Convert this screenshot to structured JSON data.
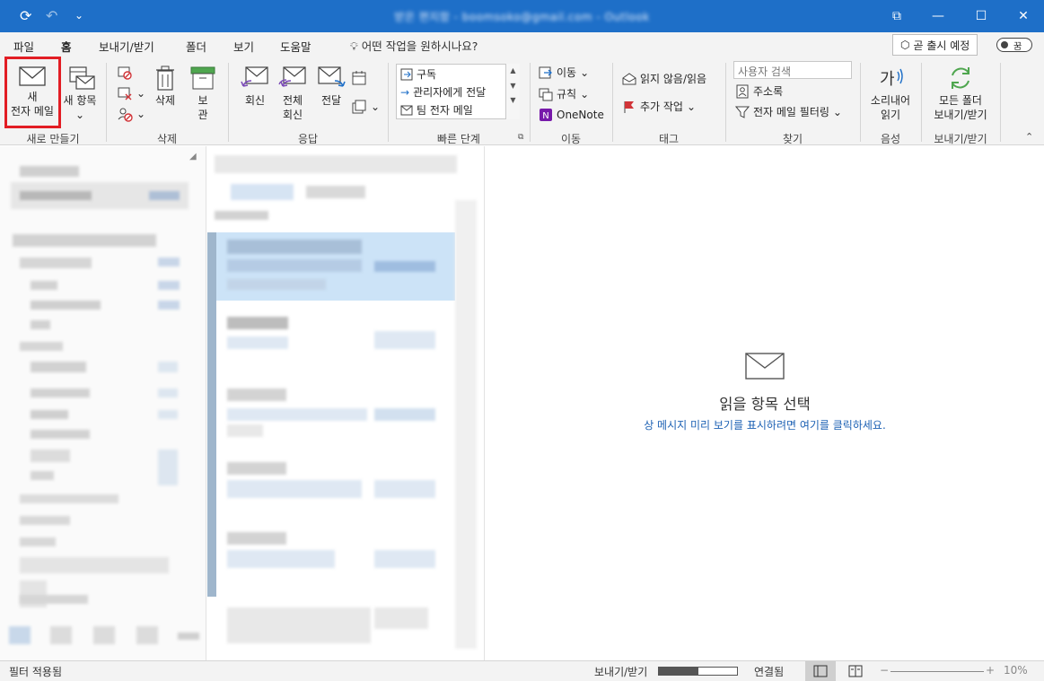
{
  "window": {
    "title": "받은 편지함 - boomsoko@gmail.com - Outlook",
    "controls": {
      "restore": "⧉",
      "minimize": "—",
      "maximize": "☐",
      "close": "✕"
    }
  },
  "quick_access": {
    "sync": "⟳",
    "undo": "↶",
    "customize": "⌄"
  },
  "tabs": [
    "파일",
    "홈",
    "보내기/받기",
    "폴더",
    "보기",
    "도움말"
  ],
  "active_tab": "홈",
  "tell_me": "어떤 작업을 원하시나요?",
  "coming_soon": "곧 출시 예정",
  "toggle_label": "꿈",
  "ribbon": {
    "new_group": {
      "label": "새로 만들기",
      "new_email_line1": "새",
      "new_email_line2": "전자 메일",
      "new_items_line1": "새 항목"
    },
    "delete_group": {
      "label": "삭제",
      "delete": "삭제",
      "archive_line1": "보",
      "archive_line2": "관"
    },
    "respond_group": {
      "label": "응답",
      "reply": "회신",
      "reply_all_line1": "전체",
      "reply_all_line2": "회신",
      "forward": "전달"
    },
    "quicksteps_group": {
      "label": "빠른 단계",
      "items": [
        "구독",
        "관리자에게 전달",
        "팀 전자 메일"
      ]
    },
    "move_group": {
      "label": "이동",
      "move": "이동",
      "rules": "규칙",
      "onenote": "OneNote"
    },
    "tags_group": {
      "label": "태그",
      "unread_read": "읽지 않음/읽음",
      "follow_up": "추가 작업"
    },
    "find_group": {
      "label": "찾기",
      "search_people_placeholder": "사용자 검색",
      "address_book": "주소록",
      "filter_email": "전자 메일 필터링"
    },
    "speech_group": {
      "label": "음성",
      "read_aloud_line1": "소리내어",
      "read_aloud_line2": "읽기"
    },
    "sendreceive_group": {
      "label": "보내기/받기",
      "send_all_line1": "모든 폴더",
      "send_all_line2": "보내기/받기"
    }
  },
  "reading_pane": {
    "title": "읽을 항목 선택",
    "link": "상 메시지 미리 보기를 표시하려면 여기를 클릭하세요."
  },
  "status_bar": {
    "filter_applied": "필터 적용됨",
    "send_receive": "보내기/받기",
    "progress": 0.5,
    "connected": "연결됨",
    "zoom_minus": "−",
    "zoom_plus": "+",
    "zoom": "10%"
  },
  "colors": {
    "accent": "#1e6fc8",
    "highlight": "#e21d24",
    "selected_row": "#cce3f7"
  }
}
